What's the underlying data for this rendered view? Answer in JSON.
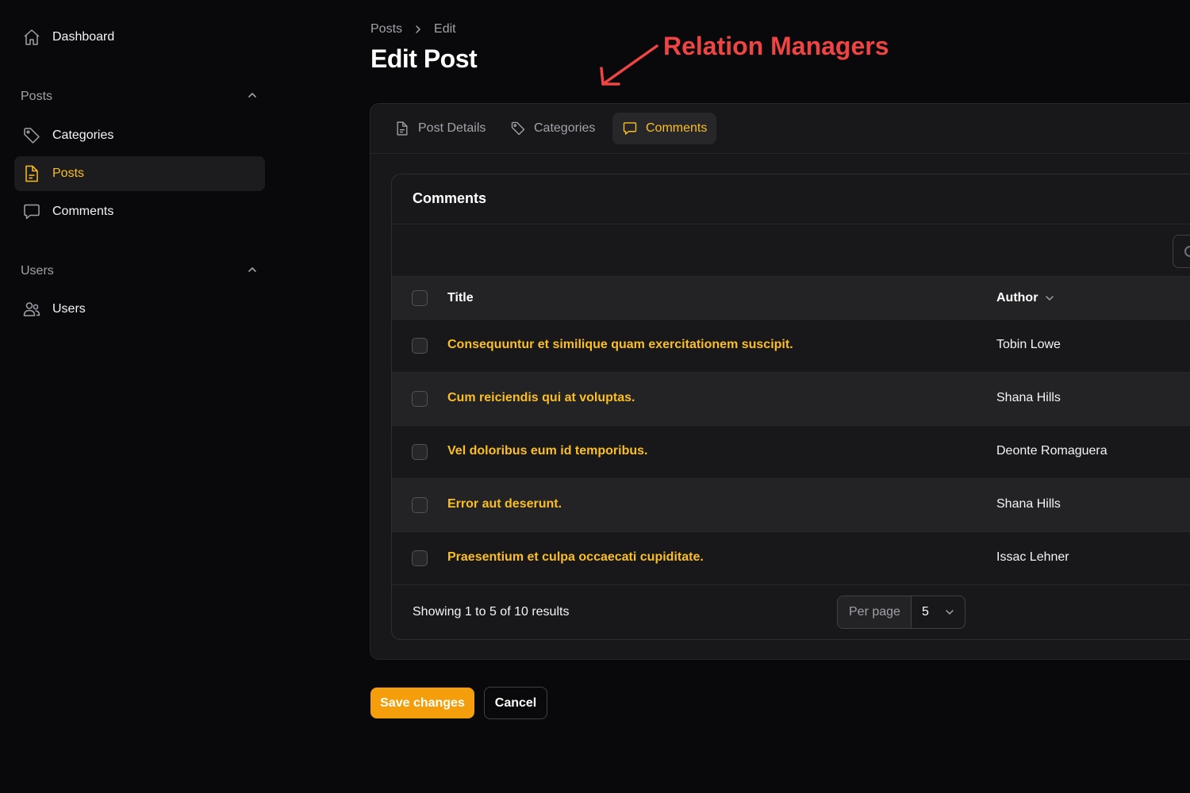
{
  "sidebar": {
    "dashboard": {
      "label": "Dashboard",
      "icon": "home-icon"
    },
    "groups": [
      {
        "label": "Posts",
        "items": [
          {
            "label": "Categories",
            "icon": "tag-icon"
          },
          {
            "label": "Posts",
            "icon": "document-icon",
            "active": true
          },
          {
            "label": "Comments",
            "icon": "chat-bubble-icon"
          }
        ]
      },
      {
        "label": "Users",
        "items": [
          {
            "label": "Users",
            "icon": "users-icon"
          }
        ]
      }
    ]
  },
  "header": {
    "breadcrumb": [
      "Posts",
      "Edit"
    ],
    "title": "Edit Post"
  },
  "annotation": {
    "text": "Relation Managers",
    "color": "#ef4444"
  },
  "tabs": [
    {
      "label": "Post Details",
      "icon": "document-icon"
    },
    {
      "label": "Categories",
      "icon": "tag-icon"
    },
    {
      "label": "Comments",
      "icon": "chat-bubble-icon",
      "active": true
    }
  ],
  "table": {
    "heading": "Comments",
    "columns": {
      "title": "Title",
      "author": "Author"
    },
    "rows": [
      {
        "title": "Consequuntur et similique quam exercitationem suscipit.",
        "author": "Tobin Lowe"
      },
      {
        "title": "Cum reiciendis qui at voluptas.",
        "author": "Shana Hills"
      },
      {
        "title": "Vel doloribus eum id temporibus.",
        "author": "Deonte Romaguera"
      },
      {
        "title": "Error aut deserunt.",
        "author": "Shana Hills"
      },
      {
        "title": "Praesentium et culpa occaecati cupiditate.",
        "author": "Issac Lehner"
      }
    ],
    "summary": "Showing 1 to 5 of 10 results",
    "per_page_label": "Per page",
    "per_page_value": "5"
  },
  "actions": {
    "save": "Save changes",
    "cancel": "Cancel"
  },
  "colors": {
    "accent": "#fbbf24",
    "primary_button": "#f59e0b",
    "background": "#09090b",
    "card": "#18181b"
  }
}
